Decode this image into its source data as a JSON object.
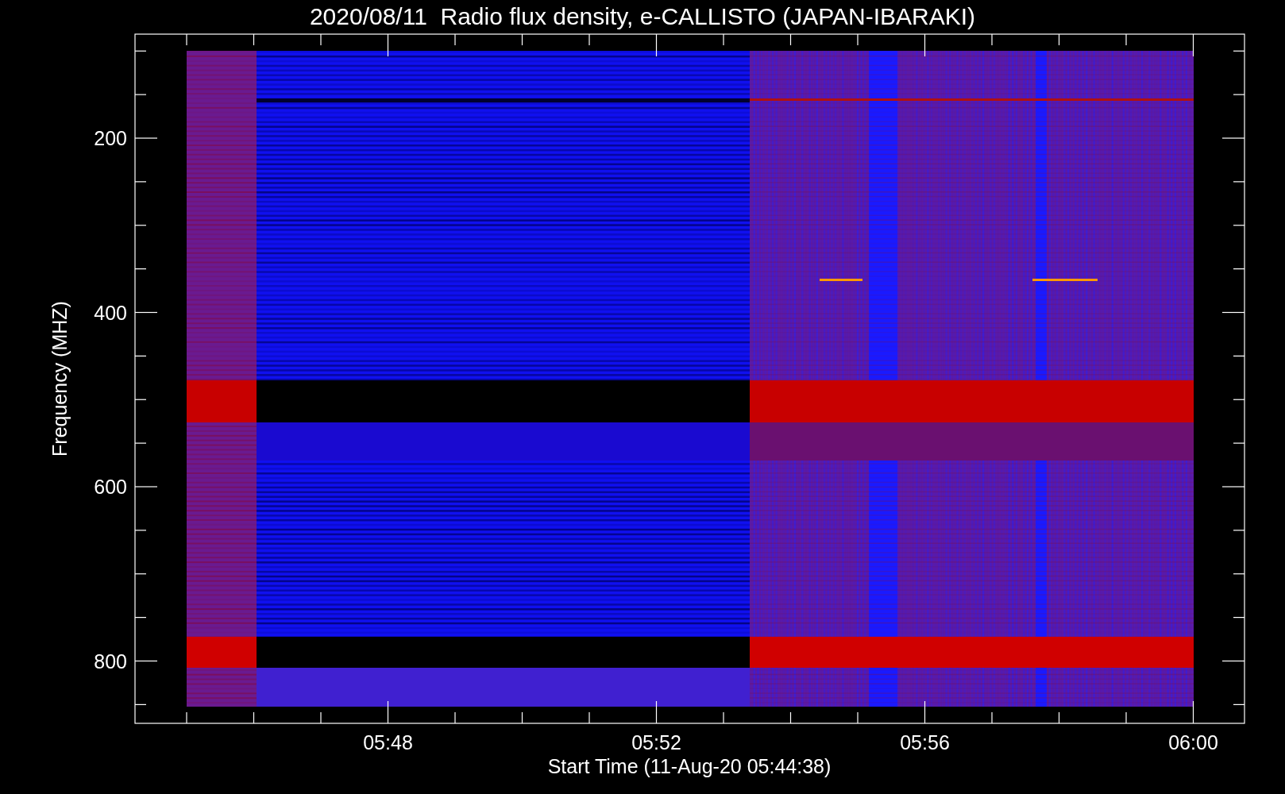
{
  "title": "2020/08/11  Radio flux density, e-CALLISTO (JAPAN-IBARAKI)",
  "ylabel": "Frequency (MHZ)",
  "xlabel": "Start Time (11-Aug-20 05:44:38)",
  "yticks": [
    "200",
    "400",
    "600",
    "800"
  ],
  "xticks": [
    "05:48",
    "05:52",
    "05:56",
    "06:00"
  ]
}
